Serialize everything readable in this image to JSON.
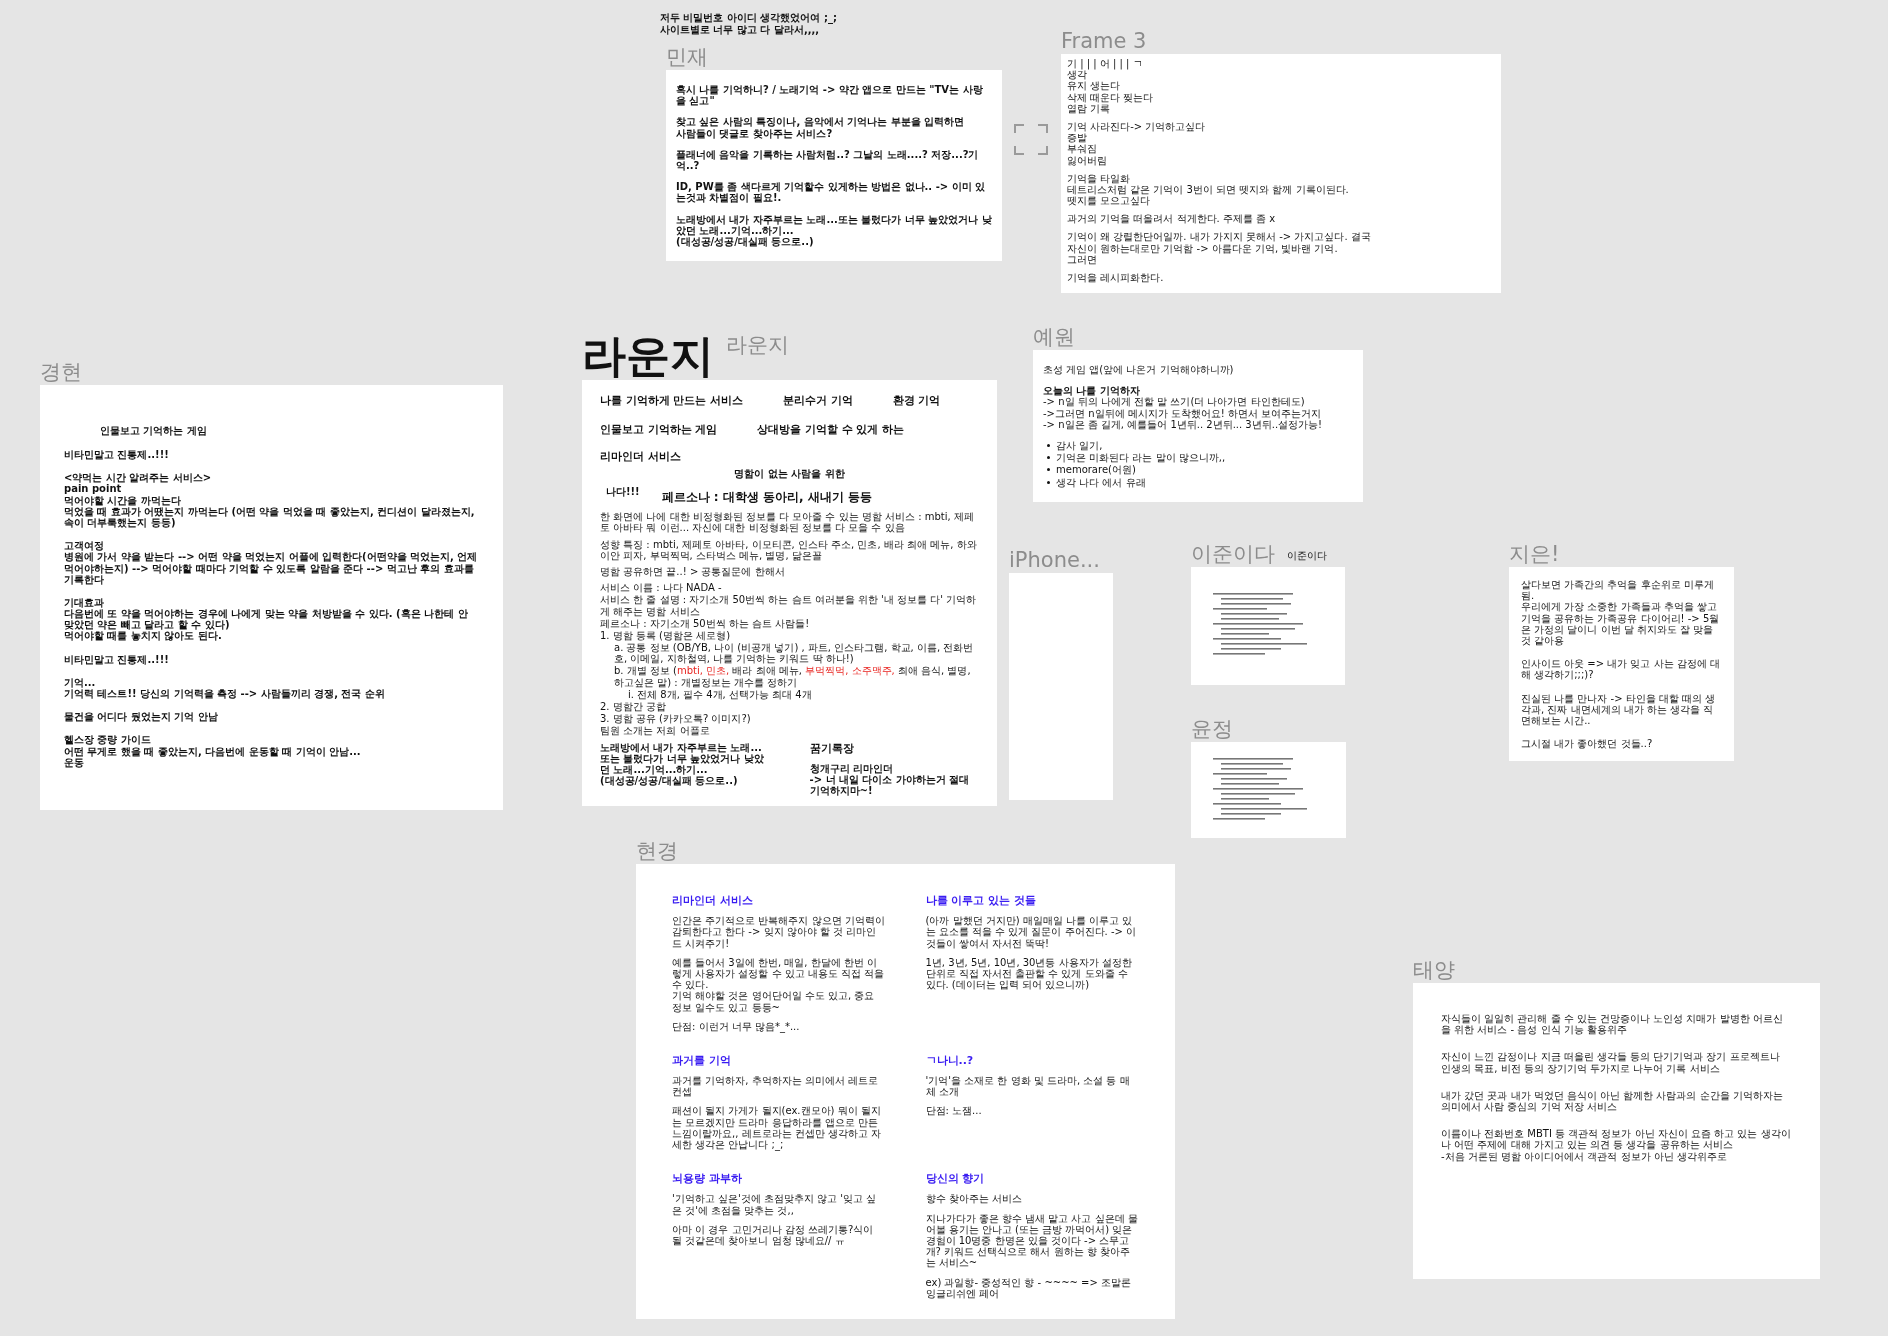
{
  "note": {
    "lines": [
      "저두 비밀번호 아이디 생각했었어여 ;_;",
      "사이트별로 너무 많고 다 달라서,,,,"
    ]
  },
  "frames": [
    {
      "label": "민재",
      "blocks": [
        {
          "kind": "text",
          "bold": true,
          "lines": [
            "혹시 나를 기억하니? / 노래기억 -> 약간 앱으로 만드는 \"TV는 사랑을 싣고\""
          ]
        },
        {
          "kind": "text",
          "bold": true,
          "lines": [
            "찾고 싶은 사람의 특징이나, 음악에서 기억나는 부분을 입력하면",
            "사람들이 댓글로 찾아주는 서비스?"
          ]
        },
        {
          "kind": "text",
          "bold": true,
          "lines": [
            "플래너에 음악을 기록하는 사람처럼..? 그날의 노래....? 저장...?기억..?"
          ]
        },
        {
          "kind": "text",
          "bold": true,
          "lines": [
            "ID, PW를 좀 색다르게 기억할수 있게하는 방법은 없나.. -> 이미 있는것과 차별점이 필요!."
          ]
        },
        {
          "kind": "text",
          "bold": true,
          "lines": [
            "노래방에서 내가 자주부르는 노래...또는 불렀다가 너무 높았었거나 낮았던 노래...기억...하기...",
            "(대성공/성공/대실패 등으로..)"
          ]
        }
      ]
    },
    {
      "label": "Frame 3",
      "blocks": [
        {
          "kind": "text",
          "bold": false,
          "lines": [
            "기 | | | 어 | | | ㄱ",
            "생각",
            "유지 생는다",
            "삭제 때운다 찢는다",
            "열람 기록"
          ]
        },
        {
          "kind": "text",
          "bold": false,
          "lines": [
            "기억 사라진다-> 기억하고싶다",
            "증발",
            "부숴짐",
            "잃어버림"
          ]
        },
        {
          "kind": "text",
          "bold": false,
          "lines": [
            "기억을 타일화",
            "테트리스처럼 같은 기억이 3번이 되면 뗏지와 함께 기록이된다.",
            "뗏지를 모으고싶다"
          ]
        },
        {
          "kind": "text",
          "bold": false,
          "lines": [
            "과거의 기억을 떠올려서 적게한다. 주제를 좀  x"
          ]
        },
        {
          "kind": "text",
          "bold": false,
          "lines": [
            "기억이 왜 강렬한단어일까. 내가 가지지 못해서 -> 가지고싶다. 결국",
            "자신이 원하는대로만 기억함 -> 아름다운 기억, 빛바랜 기억.",
            "그러면"
          ]
        },
        {
          "kind": "text",
          "bold": false,
          "lines": [
            "기억을 레시피화한다."
          ]
        }
      ]
    },
    {
      "label": "예원",
      "blocks": [
        {
          "kind": "text",
          "bold": false,
          "lines": [
            "초성 게임 앱(앞에 나온거 기억해야하니까)"
          ]
        },
        {
          "kind": "text",
          "bold": false,
          "lines": [
            "**오늘의 나를 기억하자**",
            "-> n일 뒤의 나에게 전할 말 쓰기(더 나아가면 타인한테도)",
            "->그러면 n일뒤에 메시지가 도착했어요! 하면서 보여주는거지",
            "-> n일은 좀 길게, 예를들어 1년뒤.. 2년뒤... 3년뒤..설정가능!"
          ]
        },
        {
          "kind": "bullets",
          "items": [
            "감사 일기,",
            "기억은 미화된다 라는 말이 많으니까,,",
            "memorare(어원)",
            "생각 나다  에서 유래"
          ]
        }
      ]
    },
    {
      "label": "경현",
      "blocks": [
        {
          "kind": "title",
          "text": "인물보고 기억하는 게임"
        },
        {
          "kind": "text",
          "bold": true,
          "lines": [
            "비타민말고 진통제..!!!"
          ]
        },
        {
          "kind": "text",
          "bold": true,
          "lines": [
            "<약먹는 시간 알려주는 서비스>",
            "pain point",
            "먹어야할 시간을 까먹는다",
            "먹었을 때 효과가 어땠는지 까먹는다 (어떤 약을 먹었을 때 좋았는지, 컨디션이 달라졌는지, 속이 더부룩했는지 등등)"
          ]
        },
        {
          "kind": "text",
          "bold": true,
          "lines": [
            "고객여정",
            "병원에 가서 약을 받는다 --> 어떤 약을 먹었는지 어플에 입력한다(어떤약을 먹었는지, 언제 먹어야하는지) --> 먹어야할 때마다 기억할 수 있도록 알람을 준다 --> 먹고난 후의 효과를 기록한다"
          ]
        },
        {
          "kind": "text",
          "bold": true,
          "lines": [
            "기대효과",
            "다음번에 또 약을 먹어야하는 경우에 나에게 맞는 약을 처방받을 수 있다. (혹은 나한테 안 맞았던 약은 빼고 달라고 할 수 있다)",
            "먹어야할 때를 놓치지 않아도 된다."
          ]
        },
        {
          "kind": "text",
          "bold": true,
          "lines": [
            "비타민말고 진통제..!!!"
          ]
        },
        {
          "kind": "text",
          "bold": true,
          "lines": [
            "기억...",
            "기억력 테스트!! 당신의 기억력을 측정 --> 사람들끼리 경쟁, 전국 순위"
          ]
        },
        {
          "kind": "text",
          "bold": true,
          "lines": [
            "물건을 어디다 뒀었는지 기억 안남"
          ]
        },
        {
          "kind": "text",
          "bold": true,
          "lines": [
            "헬스장 중량 가이드",
            "어떤 무게로 했을 때 좋았는지, 다음번에 운동할 때 기억이 안남...",
            "운동"
          ]
        }
      ]
    },
    {
      "label": "라운지",
      "title": {
        "kind": "big",
        "text": "라운지"
      },
      "blocks": [
        {
          "kind": "row",
          "items": [
            "나를 기억하게 만드는 서비스",
            "분리수거 기억",
            "환경 기억"
          ]
        },
        {
          "kind": "row",
          "items": [
            "인물보고 기억하는 게임",
            "상대방을 기억할 수 있게 하는"
          ]
        },
        {
          "kind": "heading",
          "text": "리마인더 서비스"
        },
        {
          "kind": "caption",
          "text": "명함이 없는 사람을 위한"
        },
        {
          "kind": "persona",
          "tag": "나다!!!",
          "title": "페르소나 : 대학생 동아리,  새내기 등등"
        },
        {
          "kind": "text",
          "bold": false,
          "lines": [
            "한 화면에 나에 대한 비정형화된 정보를 다 모아줄 수 있는 명함 서비스 : mbti, 제페토 아바타 뭐 이런... 자신에 대한 비정형화된 정보를 다 모을 수 있음"
          ]
        },
        {
          "kind": "text",
          "bold": false,
          "lines": [
            "성향 특징 : mbti, 제페토 아바타, 이모티콘, 인스타 주소, 민초, 배라 최애 메뉴, 하와이안 피자,  부먹찍먹, 스타벅스 메뉴, 별명, 닮은꼴"
          ]
        },
        {
          "kind": "text",
          "bold": false,
          "lines": [
            "명함 공유하면 끝..! > 공통질문에 한해서"
          ]
        },
        {
          "kind": "outline",
          "items": [
            {
              "segments": [
                {
                  "text": "서비스 이름 : 나다 NADA -",
                  "highlighted": false
                }
              ]
            },
            {
              "segments": [
                {
                  "text": "서비스 한 줄 설명 : 자기소개 50번씩 하는 슴트 여러분을 위한 '내 정보를 다' 기억하게 해주는 명함 서비스",
                  "highlighted": false
                }
              ]
            },
            {
              "segments": [
                {
                  "text": "페르소나 : 자기소개 50번씩 하는 슴트 사람들!",
                  "highlighted": false
                }
              ]
            },
            {
              "segments": [
                {
                  "text": "1. 명함 등록 (명함은 세로형)",
                  "highlighted": false
                }
              ],
              "children": [
                {
                  "segments": [
                    {
                      "text": "a. 공통 정보 (OB/YB, 나이 (비공개 넣기) , 파트, 인스타그램, 학교, 이름, 전화번호, 이메일, 지하철역, 나를 기억하는 키워드 딱 하나!)",
                      "highlighted": false
                    }
                  ]
                },
                {
                  "segments": [
                    {
                      "text": "b. 개별 정보 (",
                      "highlighted": false
                    },
                    {
                      "text": "mbti, 민초,",
                      "highlighted": true
                    },
                    {
                      "text": " 배라 최애 메뉴, ",
                      "highlighted": false
                    },
                    {
                      "text": "부먹찍먹, 소주맥주,",
                      "highlighted": true
                    },
                    {
                      "text": " 최애 음식, 별명, 하고싶은 말) : 개별정보는 개수를 정하기",
                      "highlighted": false
                    }
                  ],
                  "children": [
                    {
                      "segments": [
                        {
                          "text": "i. 전체 8개, 필수 4개, 선택가능 최대 4개",
                          "highlighted": false
                        }
                      ]
                    }
                  ]
                }
              ]
            },
            {
              "segments": [
                {
                  "text": "2. 명함간 궁합",
                  "highlighted": false
                }
              ]
            },
            {
              "segments": [
                {
                  "text": "3. 명함 공유 (카카오톡? 이미지?)",
                  "highlighted": false
                }
              ]
            },
            {
              "segments": [
                {
                  "text": "팀원 소개는 저희 어플로",
                  "highlighted": false
                }
              ]
            }
          ]
        },
        {
          "kind": "grid",
          "cells": [
            {
              "blocks": [
                {
                  "kind": "text",
                  "bold": true,
                  "lines": [
                    "노래방에서 내가 자주부르는 노래...또는 불렀다가 너무 높았었거나 낮았던 노래...기억...하기...",
                    "(대성공/성공/대실패 등으로..)"
                  ]
                }
              ]
            },
            {
              "blocks": [
                {
                  "kind": "heading",
                  "text": "꿈기록장"
                },
                {
                  "kind": "text",
                  "bold": true,
                  "lines": [
                    "청개구리 리마인더",
                    "-> 너 내일 다이소 가야하는거 절대 기억하지마~!"
                  ]
                }
              ]
            }
          ]
        }
      ]
    },
    {
      "label": "iPhone..."
    },
    {
      "label": "이준이다",
      "title": {
        "kind": "small",
        "text": "이준이다"
      },
      "blocks": [
        {
          "kind": "scribble"
        }
      ]
    },
    {
      "label": "지은!",
      "blocks": [
        {
          "kind": "text",
          "bold": false,
          "lines": [
            "살다보면 가족간의 추억을 후순위로 미루게 됨.",
            "우리에게 가장 소중한 가족들과 추억을 쌓고 기억을 공유하는 가족공유 다이어리!  -> 5월은 가정의 달이니 이번 달 취지와도 잘 맞을 것 같아용"
          ]
        },
        {
          "kind": "text",
          "bold": false,
          "lines": [
            "인사이드 아웃 => 내가 잊고 사는 감정에 대해 생각하기;;;)?"
          ]
        },
        {
          "kind": "text",
          "bold": false,
          "lines": [
            "진실된 나를 만나자 -> 타인을 대할 때의 생각과, 진짜 내면세계의 내가 하는 생각을 직면해보는 시간.."
          ]
        },
        {
          "kind": "text",
          "bold": false,
          "lines": [
            "그시절 내가 좋아했던 것들..?"
          ]
        }
      ]
    },
    {
      "label": "윤정",
      "blocks": [
        {
          "kind": "scribble"
        }
      ]
    },
    {
      "label": "현경",
      "blocks": [
        {
          "kind": "grid",
          "cells": [
            {
              "blocks": [
                {
                  "kind": "section_title",
                  "text": "리마인더 서비스"
                },
                {
                  "kind": "text",
                  "bold": false,
                  "lines": [
                    "인간은 주기적으로 반복해주지 않으면 기억력이 감퇴한다고 한다 -> 잊지 않아야 할 것 리마인드 시켜주기!"
                  ]
                },
                {
                  "kind": "text",
                  "bold": false,
                  "lines": [
                    "예를 들어서 3일에 한번, 매일, 한달에 한번 이렇게 사용자가 설정할 수 있고 내용도 직접 적을 수 있다.",
                    "기억 해야할 것은 영어단어일 수도 있고, 중요 정보 일수도 있고 등등~"
                  ]
                },
                {
                  "kind": "text",
                  "bold": false,
                  "lines": [
                    "단점: 이런거 너무 많음*_*..."
                  ]
                }
              ]
            },
            {
              "blocks": [
                {
                  "kind": "section_title",
                  "text": "나를 이루고 있는 것들"
                },
                {
                  "kind": "text",
                  "bold": false,
                  "lines": [
                    "(아까 말했던 거지만) 매일매일 나를 이루고 있는 요소를 적을 수 있게 질문이 주어진다. -> 이것들이 쌓여서 자서전 뚝딱!"
                  ]
                },
                {
                  "kind": "text",
                  "bold": false,
                  "lines": [
                    "1년, 3년, 5년, 10년, 30년등 사용자가 설정한 단위로 직접 자서전 출판할 수 있게 도와줄 수 있다. (데이터는 입력 되어 있으니까)"
                  ]
                }
              ]
            },
            {
              "blocks": [
                {
                  "kind": "section_title",
                  "text": "과거를 기억"
                },
                {
                  "kind": "text",
                  "bold": false,
                  "lines": [
                    "과거를 기억하자, 추억하자는 의미에서 레트로 컨셉"
                  ]
                },
                {
                  "kind": "text",
                  "bold": false,
                  "lines": [
                    "패션이 될지 가게가 될지(ex.캔모아) 뭐이 될지는 모르겠지만 드라마 응답하라를 앱으로 만든 느낌이랄까요,, 레트로라는 컨셉만 생각하고 자세한 생각은 안납니다 ;_;"
                  ]
                }
              ]
            },
            {
              "blocks": [
                {
                  "kind": "section_title",
                  "text": "ㄱ나니..?"
                },
                {
                  "kind": "text",
                  "bold": false,
                  "lines": [
                    "'기억'을 소재로 한 영화 및 드라마, 소설 등 매체 소개"
                  ]
                },
                {
                  "kind": "text",
                  "bold": false,
                  "lines": [
                    "단점: 노잼..."
                  ]
                }
              ]
            },
            {
              "blocks": [
                {
                  "kind": "section_title",
                  "text": "뇌용량 과부하"
                },
                {
                  "kind": "text",
                  "bold": false,
                  "lines": [
                    "'기억하고 싶은'것에 초점맞추지 않고 '잊고 싶은 것'에 초점을 맞추는 것,,"
                  ]
                },
                {
                  "kind": "text",
                  "bold": false,
                  "lines": [
                    "아마 이 경우 고민거리나 감정 쓰레기통?식이 될 것같은데 찾아보니 엄청 많네요// ㅠ"
                  ]
                }
              ]
            },
            {
              "blocks": [
                {
                  "kind": "section_title",
                  "text": "당신의 향기"
                },
                {
                  "kind": "text",
                  "bold": false,
                  "lines": [
                    "향수 찾아주는 서비스"
                  ]
                },
                {
                  "kind": "text",
                  "bold": false,
                  "lines": [
                    "지나가다가 좋은 향수 냄새 맡고 사고 싶은데 물어볼 용기는 안나고 (또는 금방 까먹어서) 잊은 경험이 10명중 한명은 있을 것이다 -> 스무고개? 키워드 선택식으로 해서 원하는 향 찾아주는 서비스~"
                  ]
                },
                {
                  "kind": "text",
                  "bold": false,
                  "lines": [
                    "ex) 과일향- 중성적인 향 - ~~~~ => 조말론 잉글리쉬엔 페어"
                  ]
                }
              ]
            }
          ]
        }
      ]
    },
    {
      "label": "태양",
      "blocks": [
        {
          "kind": "text",
          "bold": false,
          "lines": [
            "자식들이 일일히 관리해 줄 수 있는 건망증이나 노인성 치매가 발병한 어르신을 위한 서비스 - 음성 인식 기능 활용위주"
          ]
        },
        {
          "kind": "text",
          "bold": false,
          "lines": [
            "자신이 느낀 감정이나 지금 떠올린 생각들 등의 단기기억과 장기 프로젝트나 인생의 목표, 비전 등의 장기기억 두가지로 나누어 기록 서비스"
          ]
        },
        {
          "kind": "text",
          "bold": false,
          "lines": [
            "내가 갔던 곳과 내가 먹었던 음식이 아닌 함께한 사람과의 순간을 기억하자는 의미에서 사람 중심의 기억 저장 서비스"
          ]
        },
        {
          "kind": "text",
          "bold": false,
          "lines": [
            "이름이나 전화번호 MBTI 등 객관적 정보가 아닌 자신이 요즘 하고 있는 생각이나 어떤 주제에 대해 가지고 있는 의견 등 생각을 공유하는 서비스",
            "-처음 거론된 명함 아이디어에서 객관적 정보가 아닌 생각위주로"
          ]
        }
      ]
    }
  ]
}
